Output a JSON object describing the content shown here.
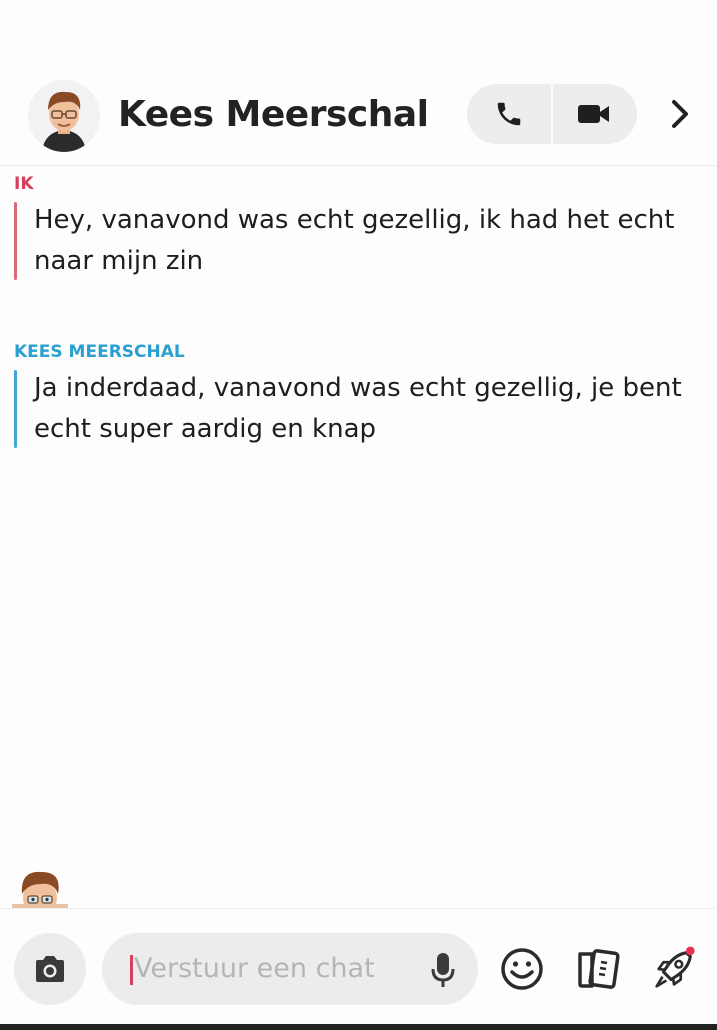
{
  "header": {
    "contact_name": "Kees Meerschal",
    "icons": {
      "avatar": "bitmoji-avatar",
      "phone": "phone-icon",
      "video": "video-camera-icon",
      "chevron": "chevron-right-icon"
    }
  },
  "messages": [
    {
      "sender": "IK",
      "text": "Hey, vanavond was echt gezellig, ik had het echt naar mijn zin",
      "color": "#d6405a"
    },
    {
      "sender": "KEES MEERSCHAL",
      "text": "Ja inderdaad, vanavond was echt gezellig, je bent echt super aardig en knap",
      "color": "#2a9fd0"
    }
  ],
  "composer": {
    "placeholder": "Verstuur een chat",
    "icons": [
      "camera-icon",
      "microphone-icon",
      "smiley-icon",
      "cards-icon",
      "rocket-icon"
    ]
  },
  "colors": {
    "me": "#d6405a",
    "them": "#2a9fd0",
    "accent_dot": "#e8324f"
  }
}
